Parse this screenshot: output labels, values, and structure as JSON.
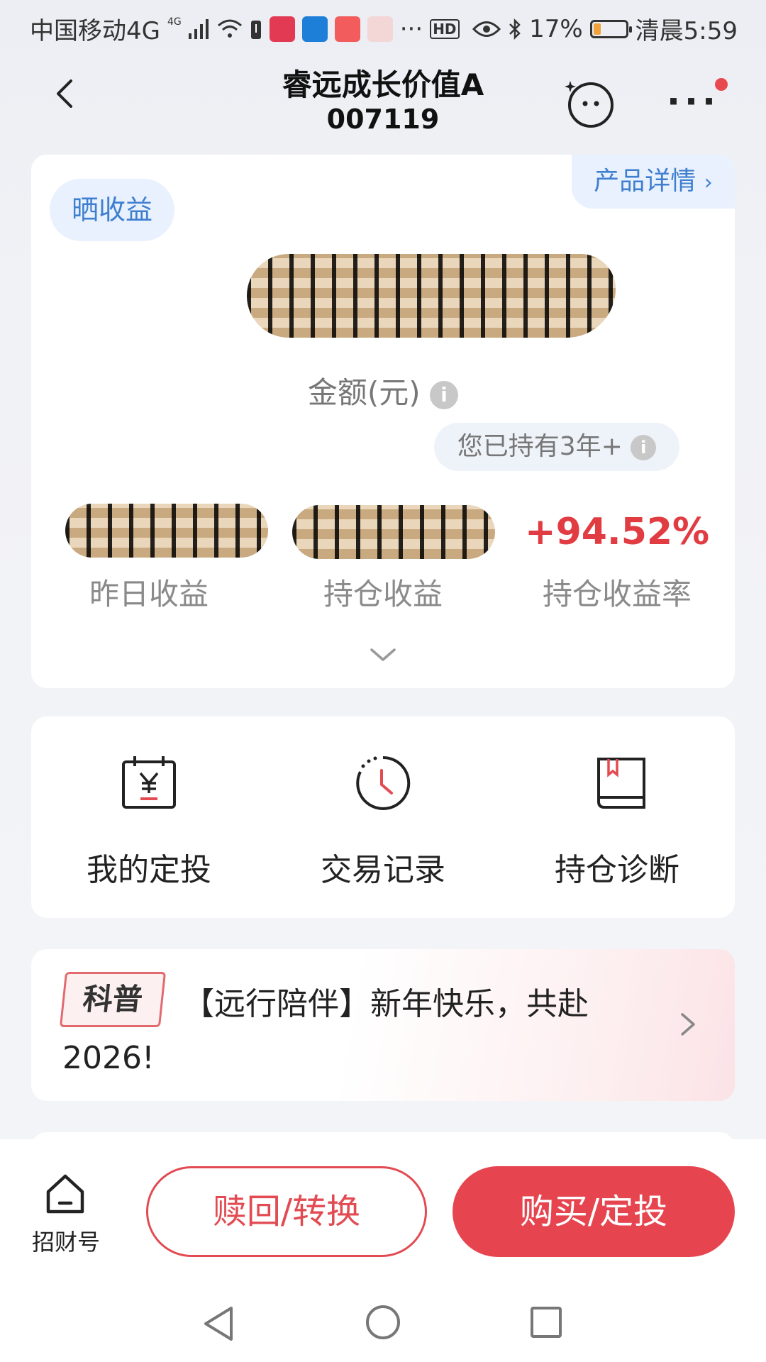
{
  "status_bar": {
    "carrier": "中国移动4G",
    "signal_badge": "4G",
    "hd_badge": "HD",
    "battery": "17%",
    "time": "清晨5:59"
  },
  "header": {
    "title": "睿远成长价值A",
    "code": "007119"
  },
  "holding_card": {
    "share_label": "晒收益",
    "product_detail_label": "产品详情",
    "amount_label": "金额(元)",
    "held_duration": "您已持有3年+",
    "yesterday_label": "昨日收益",
    "holding_profit_label": "持仓收益",
    "holding_rate_value": "+94.52%",
    "holding_rate_label": "持仓收益率"
  },
  "quick_actions": [
    {
      "label": "我的定投",
      "icon": "calendar-yen-icon"
    },
    {
      "label": "交易记录",
      "icon": "clock-history-icon"
    },
    {
      "label": "持仓诊断",
      "icon": "book-bookmark-icon"
    }
  ],
  "news": {
    "tag": "科普",
    "text": "【远行陪伴】新年快乐，共赴2026!"
  },
  "bottom_bar": {
    "home_label": "招财号",
    "redeem_label": "赎回/转换",
    "buy_label": "购买/定投"
  },
  "colors": {
    "accent_red": "#e64550",
    "link_blue": "#3f7fd0",
    "positive_red": "#e03c42"
  }
}
